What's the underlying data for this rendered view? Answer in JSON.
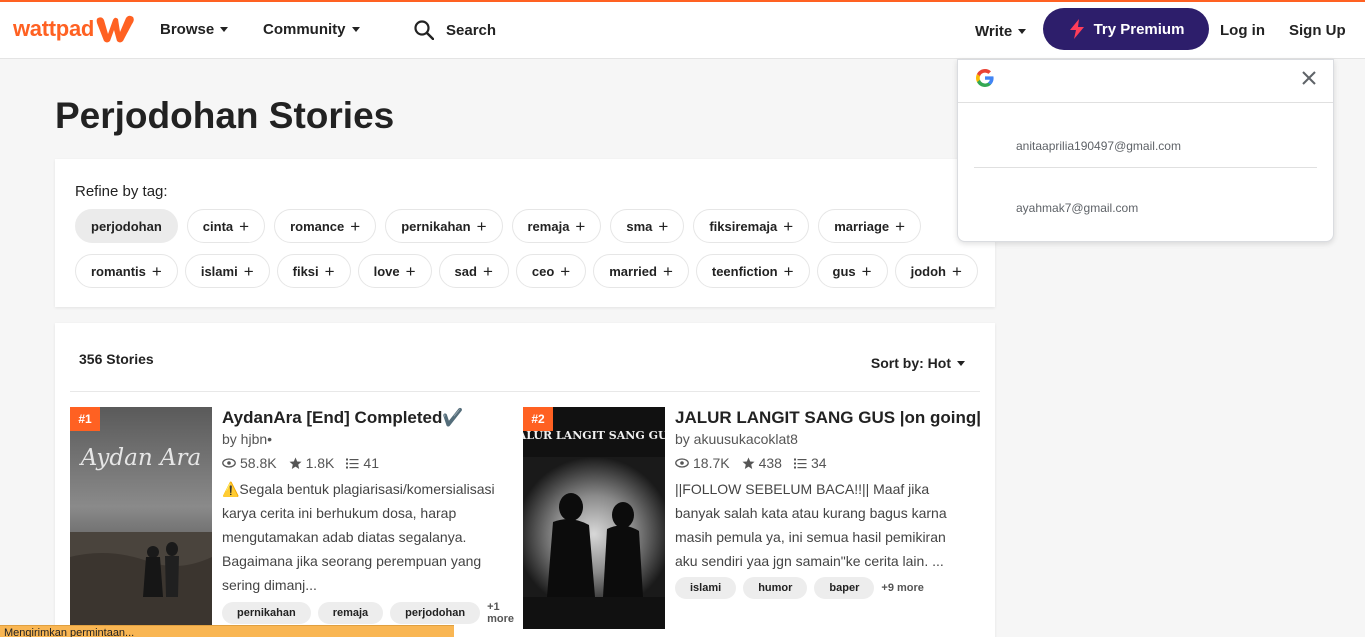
{
  "header": {
    "logo_text": "wattpad",
    "browse_label": "Browse",
    "community_label": "Community",
    "search_placeholder": "Search",
    "write_label": "Write",
    "premium_label": "Try Premium",
    "login_label": "Log in",
    "signup_label": "Sign Up"
  },
  "page": {
    "title": "Perjodohan Stories"
  },
  "refine": {
    "label": "Refine by tag:",
    "row1": [
      "perjodohan",
      "cinta",
      "romance",
      "pernikahan",
      "remaja",
      "sma",
      "fiksiremaja",
      "marriage"
    ],
    "row2": [
      "romantis",
      "islami",
      "fiksi",
      "love",
      "sad",
      "ceo",
      "married",
      "teenfiction",
      "gus",
      "jodoh"
    ]
  },
  "stories": {
    "count_label": "356 Stories",
    "sort_label": "Sort by: Hot",
    "items": [
      {
        "rank": "#1",
        "title": "AydanAra [End] Completed✔️",
        "author": "by hjbn•",
        "reads": "58.8K",
        "votes": "1.8K",
        "parts": "41",
        "description": "⚠️Segala bentuk plagiarisasi/komersialisasi karya cerita ini berhukum dosa, harap mengutamakan adab diatas segalanya. Bagaimana jika seorang perempuan yang sering dimanj...",
        "tags": [
          "pernikahan",
          "remaja",
          "perjodohan"
        ],
        "more": "+1 more",
        "cover_text": "Aydan Ara"
      },
      {
        "rank": "#2",
        "title": "JALUR LANGIT SANG GUS |on going|",
        "author": "by akuusukacoklat8",
        "reads": "18.7K",
        "votes": "438",
        "parts": "34",
        "description": "||FOLLOW SEBELUM BACA!!|| Maaf jika banyak salah kata atau kurang bagus karna masih pemula ya, ini semua hasil pemikiran aku sendiri yaa jgn samain\"ke cerita lain. ...",
        "tags": [
          "islami",
          "humor",
          "baper"
        ],
        "more": "+9 more",
        "cover_text": "\"JALUR LANGIT SANG GUS\""
      }
    ]
  },
  "google_popup": {
    "accounts": [
      "anitaaprilia190497@gmail.com",
      "ayahmak7@gmail.com"
    ]
  },
  "status": {
    "text": "Mengirimkan permintaan..."
  },
  "colors": {
    "brand": "#ff6122",
    "premium": "#2d1e6b",
    "status_bar": "#f9b653"
  }
}
